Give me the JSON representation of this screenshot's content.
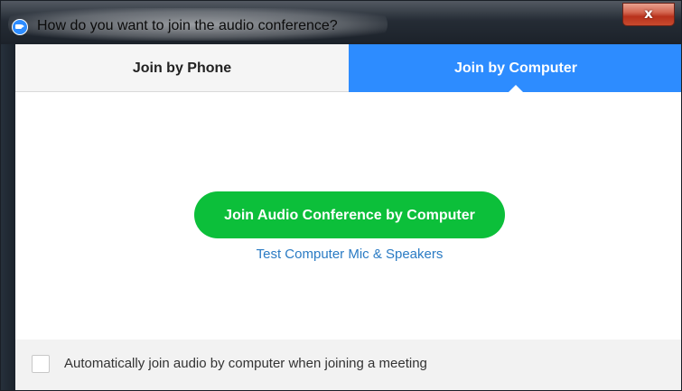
{
  "window": {
    "title": "How do you want to join the audio conference?",
    "close_label": "x"
  },
  "tabs": [
    {
      "label": "Join by Phone",
      "active": false
    },
    {
      "label": "Join by Computer",
      "active": true
    }
  ],
  "main": {
    "join_button_label": "Join Audio Conference by Computer",
    "test_link_label": "Test Computer Mic & Speakers"
  },
  "footer": {
    "auto_join_label": "Automatically join audio by computer when joining a meeting",
    "auto_join_checked": false
  },
  "colors": {
    "accent_blue": "#2d8cff",
    "join_green": "#0cbf3a",
    "link_blue": "#2a7bc4"
  }
}
